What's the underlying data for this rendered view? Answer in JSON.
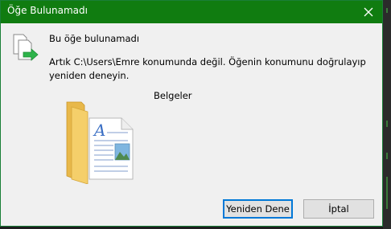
{
  "window": {
    "title": "Öğe Bulunamadı"
  },
  "message": {
    "title": "Bu öğe bulunamadı",
    "body": "Artık C:\\Users\\Emre konumunda değil. Öğenin konumunu doğrulayıp yeniden deneyin."
  },
  "item": {
    "name": "Belgeler"
  },
  "buttons": {
    "retry": "Yeniden Dene",
    "cancel": "İptal"
  },
  "icons": {
    "header": "file-copy-icon",
    "item": "folder-document-icon",
    "close": "close-icon"
  },
  "colors": {
    "titlebar": "#107c10",
    "accent": "#0078d7",
    "dialog_bg": "#f0f0f0"
  }
}
